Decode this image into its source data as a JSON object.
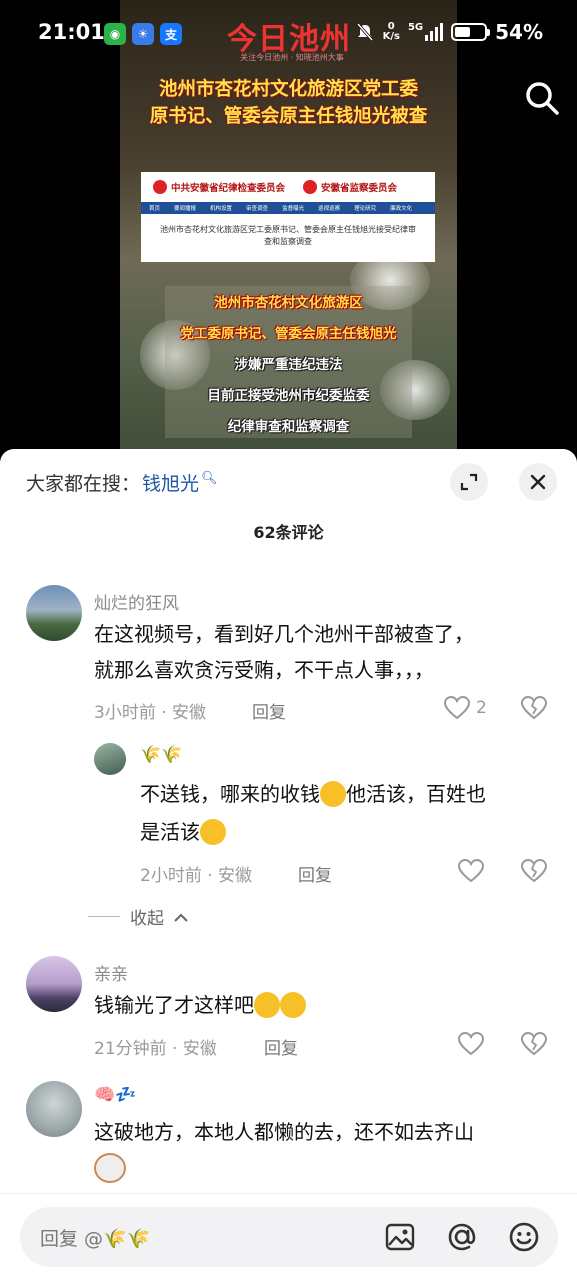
{
  "status_bar": {
    "time": "21:01",
    "speed_top": "0",
    "speed_unit": "K/s",
    "network": "5G",
    "battery_text": "54%",
    "battery_level": 0.54
  },
  "video": {
    "brand": "今日池州",
    "brand_sub": "关注今日池州 · 知晓池州大事",
    "headline_1": "池州市杏花村文化旅游区党工委",
    "headline_2": "原书记、管委会原主任钱旭光被查",
    "doc": {
      "org_left": "中共安徽省纪律检查委员会",
      "org_right": "安徽省监察委员会",
      "nav": [
        "首页",
        "要闻播报",
        "机构设置",
        "审查调查",
        "监督曝光",
        "巡视巡察",
        "理论研究",
        "廉政文化"
      ],
      "body": "池州市杏花村文化旅游区党工委原书记、管委会原主任钱旭光接受纪律审查和监察调查"
    },
    "captions": [
      "池州市杏花村文化旅游区",
      "党工委原书记、管委会原主任钱旭光",
      "涉嫌严重违纪违法",
      "目前正接受池州市纪委监委",
      "纪律审查和监察调查"
    ]
  },
  "sheet": {
    "search_prefix": "大家都在搜：",
    "search_keyword": "钱旭光",
    "comment_count": "62条评论",
    "comments": [
      {
        "name": "灿烂的狂风",
        "text_1": "在这视频号，看到好几个池州干部被查了，",
        "text_2": "就那么喜欢贪污受贿，不干点人事，，，",
        "meta": "3小时前 · 安徽",
        "reply": "回复",
        "likes": "2"
      },
      {
        "name": "🌾🌾",
        "text_1a": "不送钱，哪来的收钱",
        "text_1b": "他活该，百姓也",
        "text_2": "是活该",
        "meta": "2小时前 · 安徽",
        "reply": "回复"
      },
      {
        "name": "亲亲",
        "text_1": "钱输光了才这样吧",
        "meta": "21分钟前 · 安徽",
        "reply": "回复"
      },
      {
        "name": "🧠💤",
        "text_1": "这破地方，本地人都懒的去，还不如去齐山"
      }
    ],
    "collapse_label": "收起",
    "input_placeholder": "回复 @🌾🌾"
  },
  "colors": {
    "accent_blue": "#1d56a8",
    "brand_red": "#e33333",
    "headline_yellow": "#ffe24a"
  }
}
